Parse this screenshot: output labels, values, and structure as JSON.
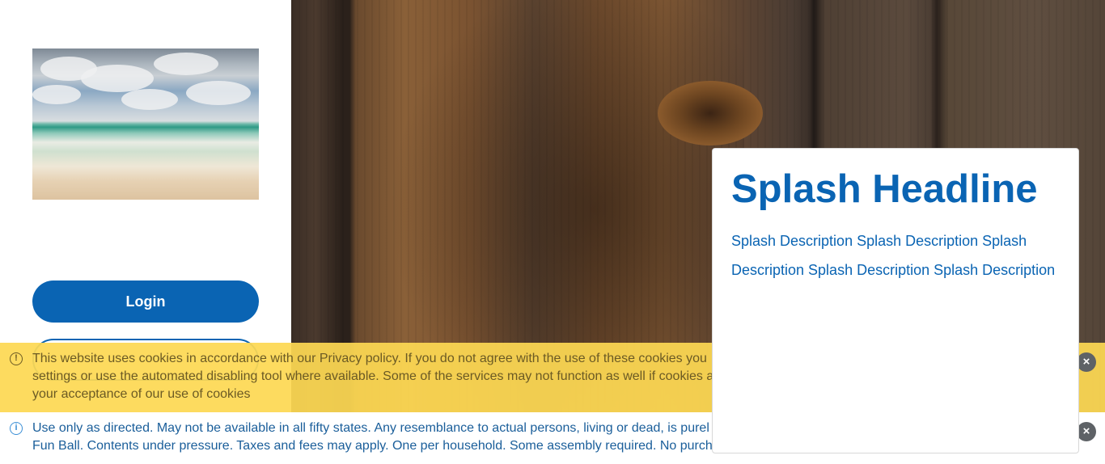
{
  "sidebar": {
    "image_alt": "beach",
    "login_label": "Login",
    "second_button_label": ""
  },
  "splash": {
    "headline": "Splash Headline",
    "line1": "Splash Description Splash Description Splash",
    "line2": "Description Splash Description Splash Description"
  },
  "cookie_banner": {
    "icon": "info-icon",
    "line1": "This website uses cookies in accordance with our Privacy policy. If you do not agree with the use of these cookies you",
    "line2": "settings or use the automated disabling tool where available. Some of the services may not function as well if cookies a",
    "line3": "your acceptance of our use of cookies",
    "close_icon": "close-icon"
  },
  "disclaimer_banner": {
    "icon": "info-icon",
    "line1": "Use only as directed. May not be available in all fifty states. Any resemblance to actual persons, living or dead, is purel",
    "line2": "Fun Ball. Contents under pressure. Taxes and fees may apply. One per household. Some assembly required. No purch",
    "close_icon": "close-icon"
  },
  "colors": {
    "brand_blue": "#0a64b3",
    "cookie_yellow": "#fdd853",
    "close_gray": "#5e6266"
  }
}
